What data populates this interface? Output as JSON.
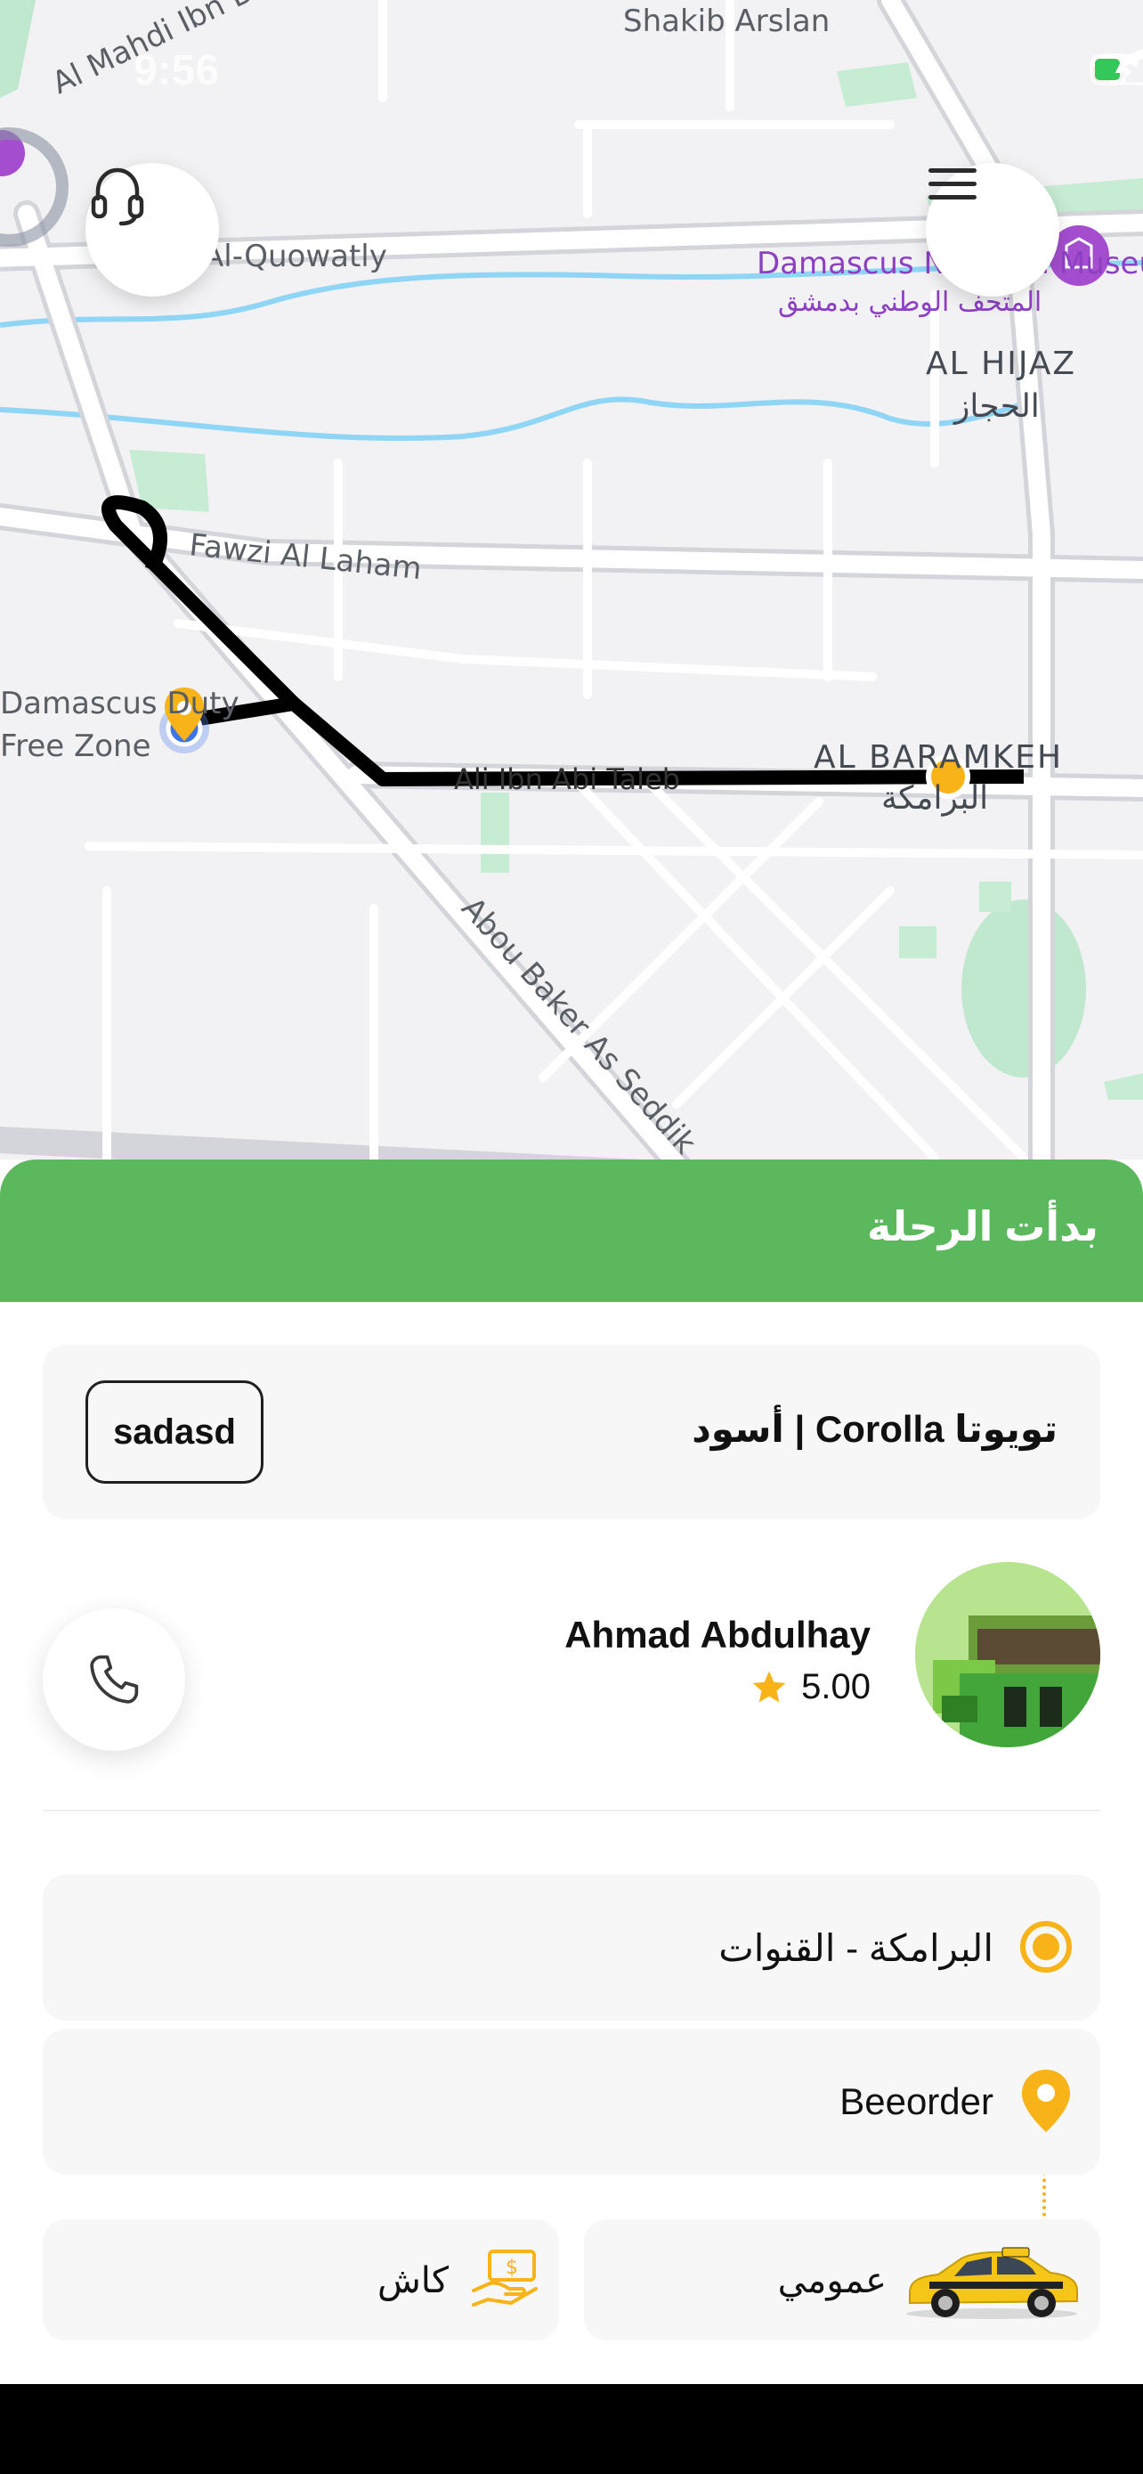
{
  "status_bar": {
    "time": "9:56"
  },
  "map": {
    "labels": {
      "shakib": "Shakib Arslan",
      "mahdi": "Al Mahdi Ibn Barakeh",
      "quowatly": "Al-Quowatly",
      "museum_en": "Damascus National Museum",
      "museum_ar": "المتحف الوطني بدمشق",
      "hijaz_en": "AL HIJAZ",
      "hijaz_ar": "الحجاز",
      "fawzi": "Fawzi Al Laham",
      "duty_free_1": "Damascus Duty",
      "duty_free_2": "Free Zone",
      "ali": "Ali Ibn Abi Taleb",
      "baramkeh_en": "AL BARAMKEH",
      "baramkeh_ar": "البرامكة",
      "abou_baker": "Abou Baker As Seddik"
    }
  },
  "trip": {
    "status": "بدأت الرحلة"
  },
  "vehicle": {
    "plate": "sadasd",
    "description": "تويوتا Corolla | أسود"
  },
  "driver": {
    "name": "Ahmad Abdulhay",
    "rating": "5.00"
  },
  "route": {
    "pickup": "البرامكة - القنوات",
    "dropoff": "Beeorder"
  },
  "ride": {
    "type": "عمومي",
    "payment": "كاش"
  },
  "colors": {
    "accent": "#5cb85c",
    "marker": "#f7b318",
    "route": "#000000"
  }
}
